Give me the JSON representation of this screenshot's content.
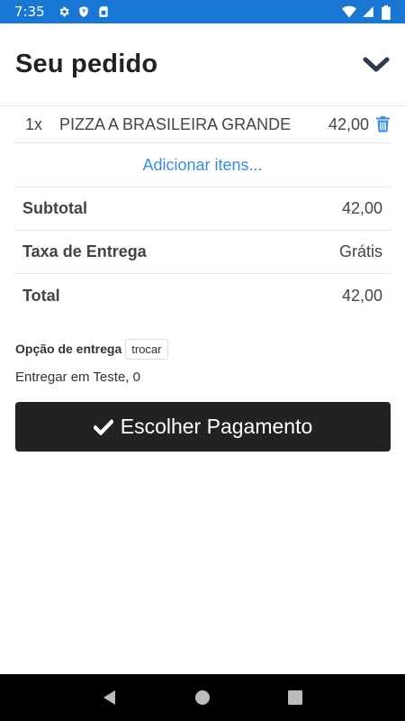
{
  "status_bar": {
    "time": "7:35",
    "left_icons": [
      "gear-icon",
      "shield-icon",
      "sim-card-icon"
    ],
    "right_icons": [
      "wifi-icon",
      "signal-icon",
      "battery-icon"
    ]
  },
  "header": {
    "title": "Seu pedido",
    "collapse_icon": "chevron-down-icon"
  },
  "order": {
    "items": [
      {
        "qty": "1x",
        "name": "PIZZA A BRASILEIRA GRANDE",
        "price": "42,00"
      }
    ],
    "add_items_label": "Adicionar itens..."
  },
  "summary": {
    "subtotal_label": "Subtotal",
    "subtotal_value": "42,00",
    "delivery_fee_label": "Taxa de Entrega",
    "delivery_fee_value": "Grátis",
    "total_label": "Total",
    "total_value": "42,00"
  },
  "delivery": {
    "option_label": "Opção de entrega",
    "change_label": "trocar",
    "address": "Entregar em Teste, 0"
  },
  "actions": {
    "pay_label": "Escolher Pagamento"
  },
  "colors": {
    "status_bar": "#1976d2",
    "link": "#3a8dde",
    "button_bg": "#222222"
  }
}
